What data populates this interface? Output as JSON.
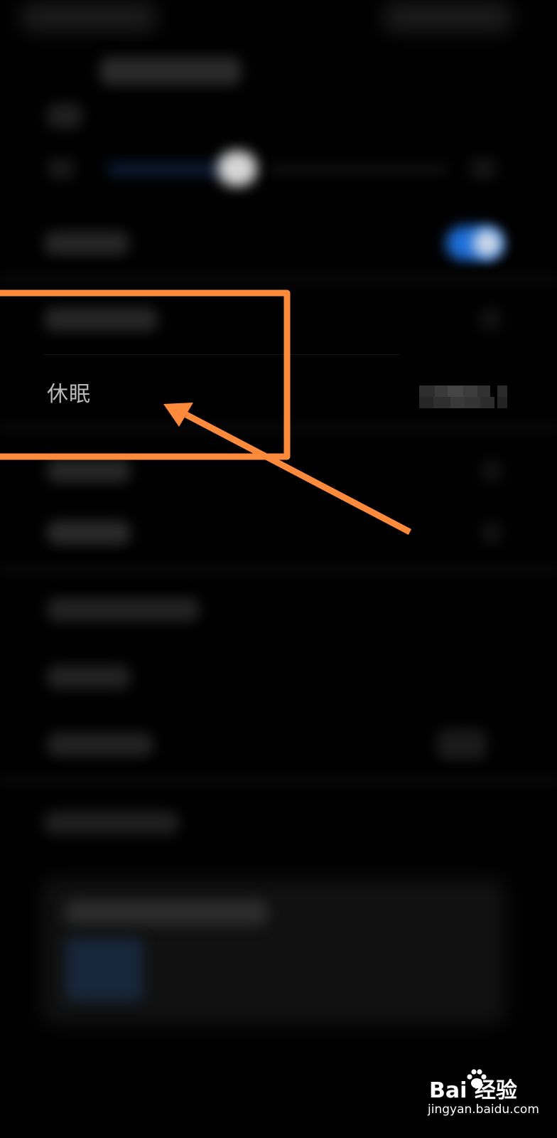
{
  "settings": {
    "sleep_row": {
      "label": "休眠",
      "value_obscured": true
    }
  },
  "annotation": {
    "color": "#FF8A3C",
    "highlight": "box around sleep row",
    "pointer": "arrow"
  },
  "watermark": {
    "brand": "Bai   经验",
    "url": "jingyan.baidu.com"
  },
  "colors": {
    "background": "#000000",
    "label_text": "#b9b9b9",
    "toggle_accent": "#1e6fd9"
  }
}
